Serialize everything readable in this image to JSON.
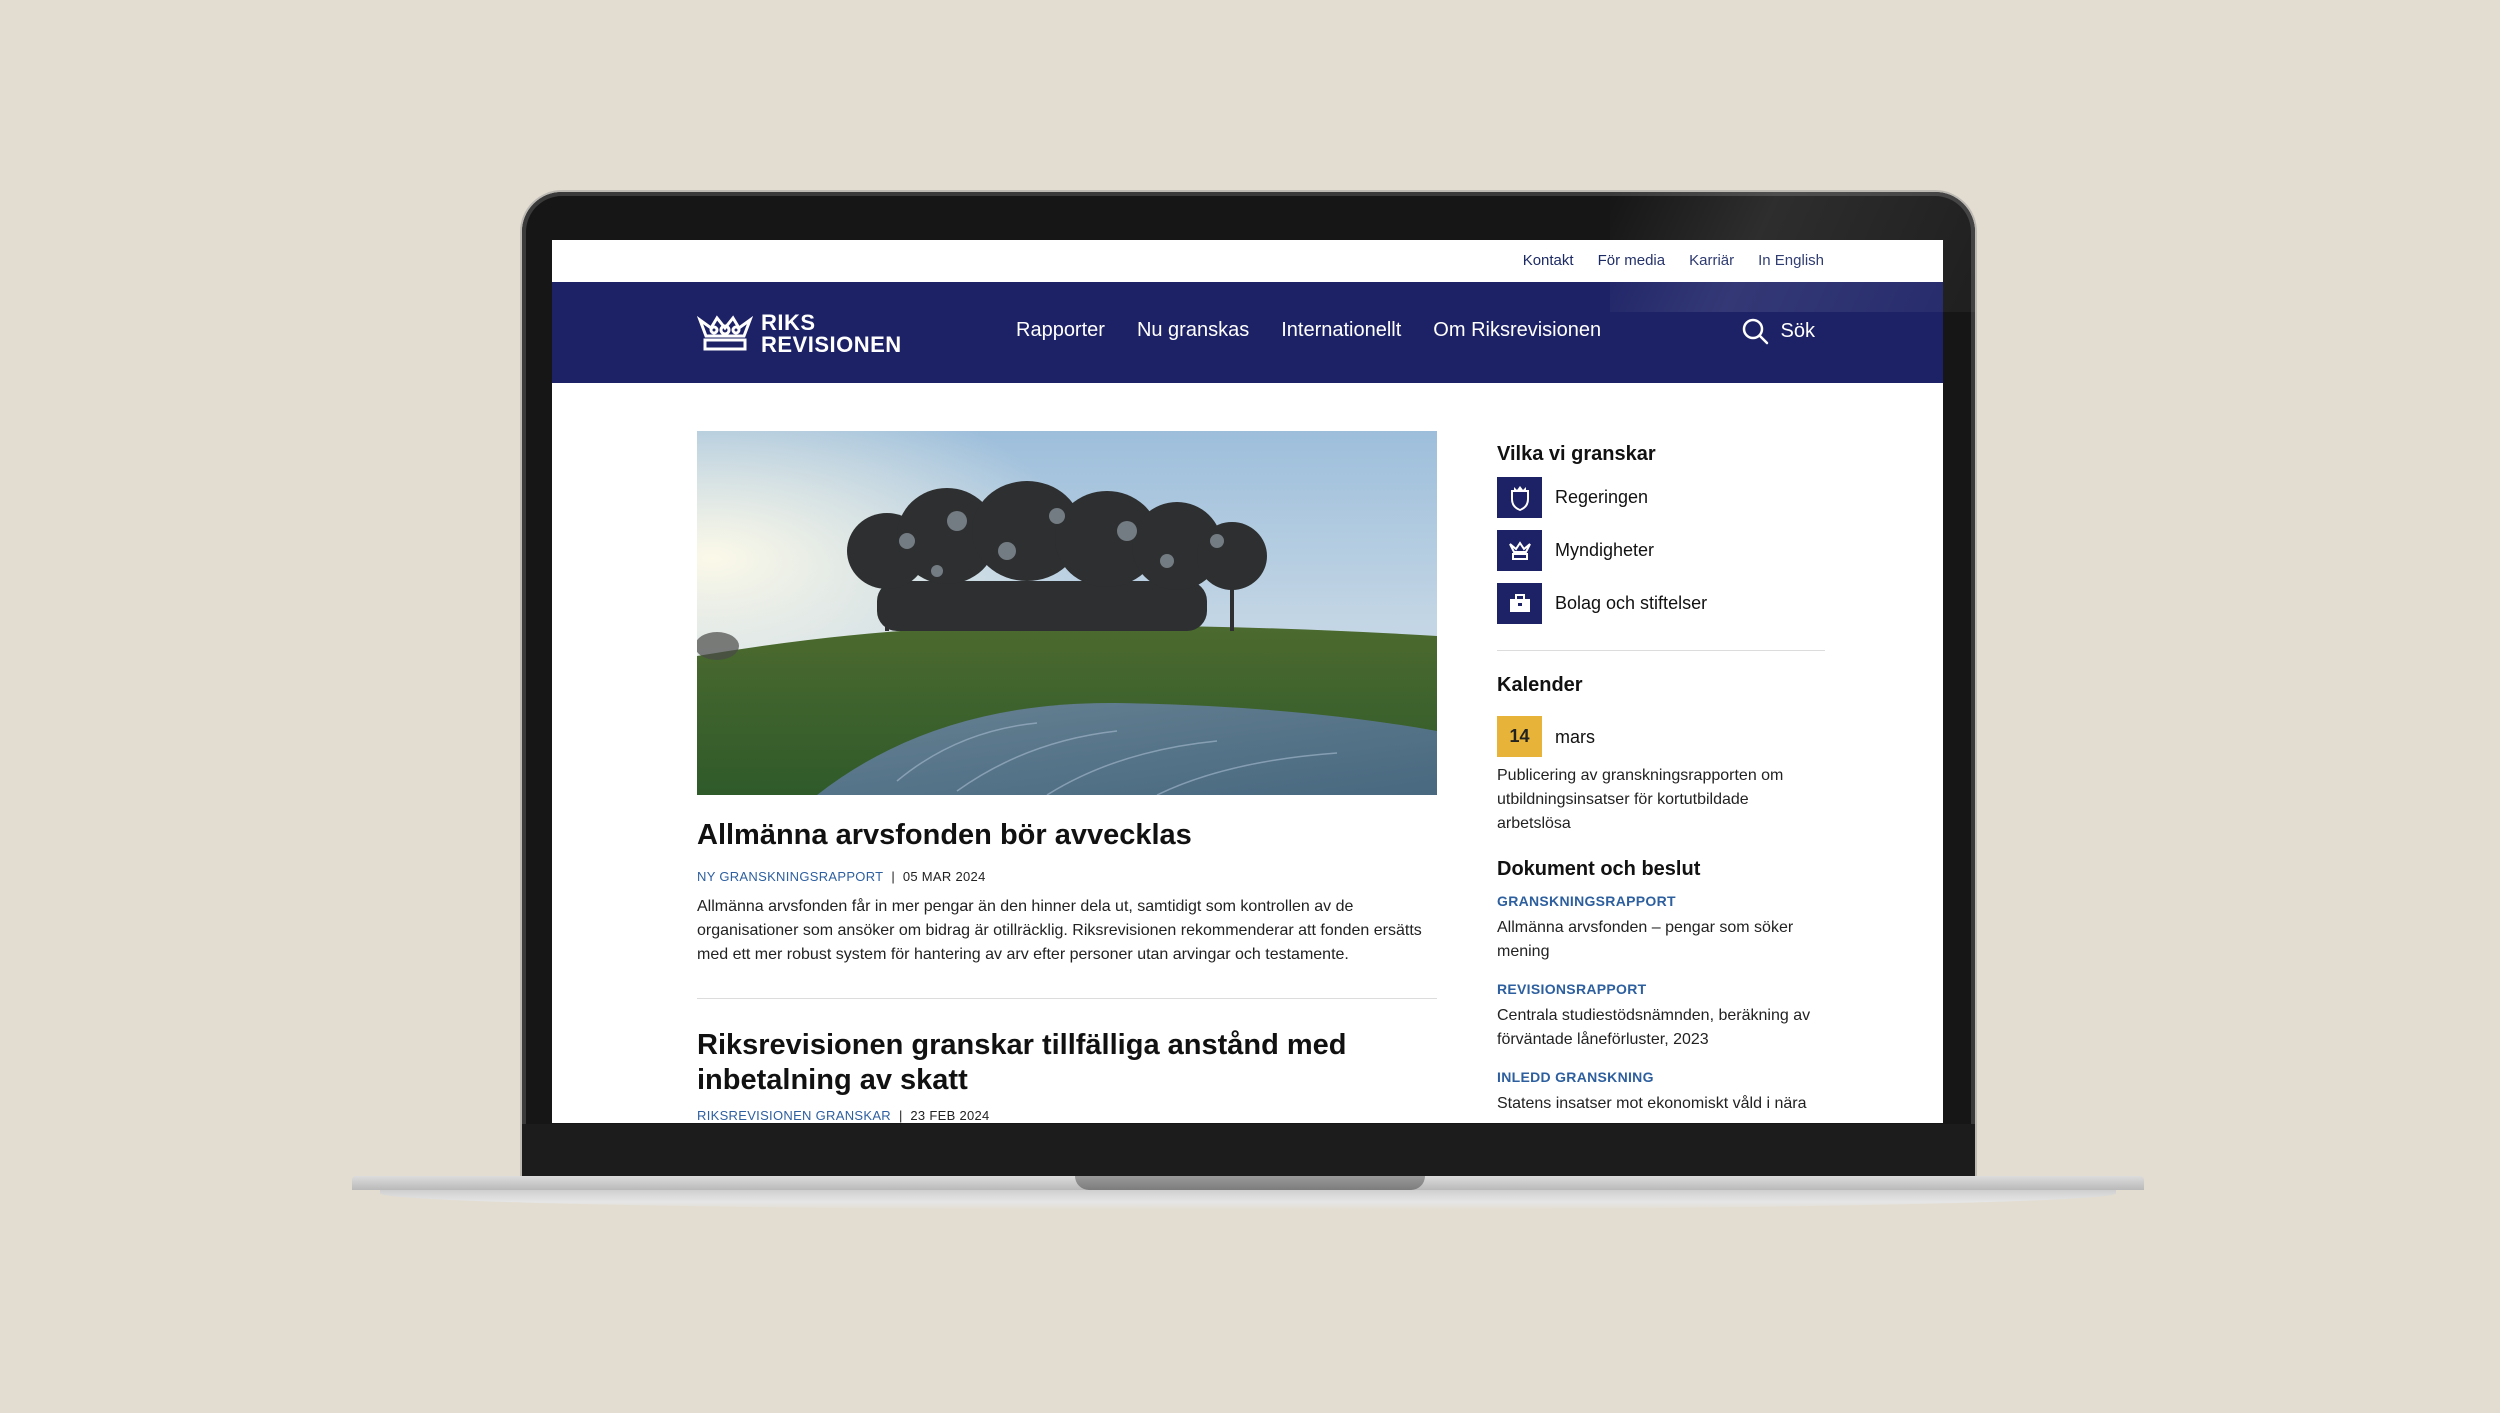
{
  "utility_nav": [
    "Kontakt",
    "För media",
    "Karriär",
    "In English"
  ],
  "logo": {
    "line1": "RIKS",
    "line2": "REVISIONEN"
  },
  "main_nav": [
    "Rapporter",
    "Nu granskas",
    "Internationellt",
    "Om Riksrevisionen"
  ],
  "search_label": "Sök",
  "articles": [
    {
      "title": "Allmänna arvsfonden bör avvecklas",
      "category": "NY GRANSKNINGSRAPPORT",
      "date": "05 MAR 2024",
      "excerpt": "Allmänna arvsfonden får in mer pengar än den hinner dela ut, samtidigt som kontrollen av de organisationer som ansöker om bidrag är otillräcklig. Riksrevisionen rekommenderar att fonden ersätts med ett mer robust system för hantering av arv efter personer utan arvingar och testamente."
    },
    {
      "title": "Riksrevisionen granskar tillfälliga anstånd med inbetalning av skatt",
      "category": "RIKSREVISIONEN GRANSKAR",
      "date": "23 FEB 2024"
    }
  ],
  "sidebar": {
    "audited_heading": "Vilka vi granskar",
    "audited": [
      {
        "label": "Regeringen",
        "icon": "government-shield-icon"
      },
      {
        "label": "Myndigheter",
        "icon": "crown-icon"
      },
      {
        "label": "Bolag och stiftelser",
        "icon": "briefcase-icon"
      }
    ],
    "calendar_heading": "Kalender",
    "calendar_day": "14",
    "calendar_month": "mars",
    "calendar_event": "Publicering av granskningsrapporten om utbildningsinsatser för kortutbildade arbetslösa",
    "documents_heading": "Dokument och beslut",
    "documents": [
      {
        "type": "GRANSKNINGSRAPPORT",
        "title": "Allmänna arvsfonden – pengar som söker mening"
      },
      {
        "type": "REVISIONSRAPPORT",
        "title": "Centrala studiestödsnämnden, beräkning av förväntade låneförluster, 2023"
      },
      {
        "type": "INLEDD GRANSKNING",
        "title": "Statens insatser mot ekonomiskt våld i nära"
      }
    ]
  },
  "colors": {
    "navy": "#1d2266",
    "link_blue": "#2d5f9f",
    "calendar_gold": "#e8b339",
    "backdrop": "#e3ddd1"
  }
}
